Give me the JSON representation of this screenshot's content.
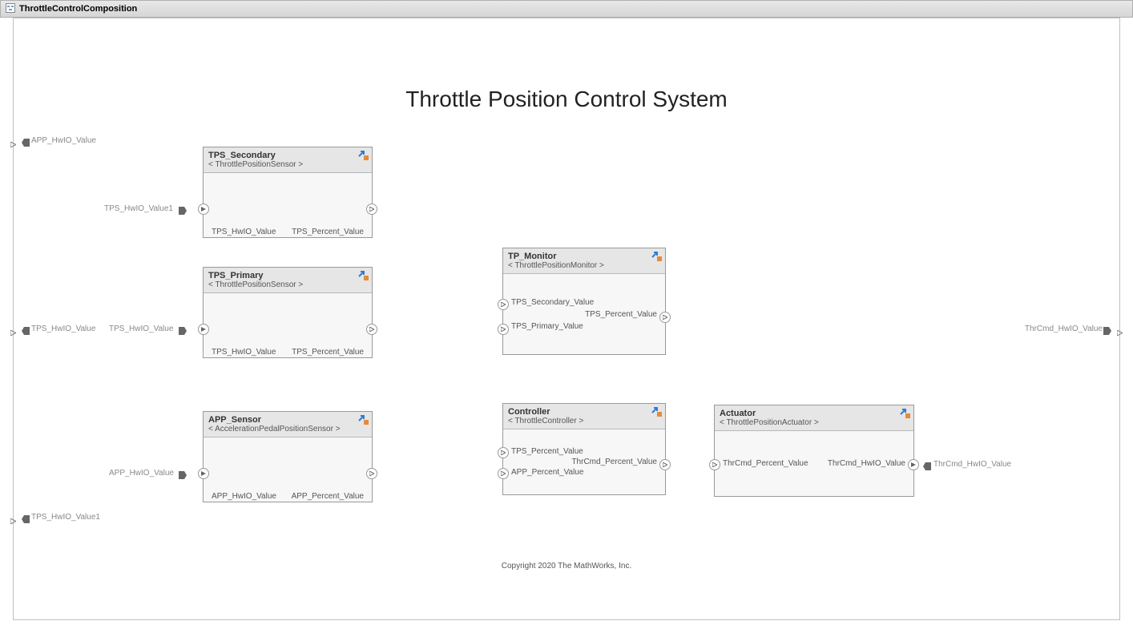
{
  "title": "ThrottleControlComposition",
  "heading": "Throttle Position Control System",
  "copyright": "Copyright 2020 The MathWorks, Inc.",
  "sideports": {
    "in1": "APP_HwIO_Value",
    "in2": "TPS_HwIO_Value",
    "in3": "TPS_HwIO_Value1",
    "out": "ThrCmd_HwIO_Value"
  },
  "extlabels": {
    "tps_sec_in": "TPS_HwIO_Value1",
    "tps_pri_in": "TPS_HwIO_Value",
    "app_in": "APP_HwIO_Value",
    "act_out": "ThrCmd_HwIO_Value"
  },
  "blocks": {
    "tps_secondary": {
      "name": "TPS_Secondary",
      "type": "< ThrottlePositionSensor >",
      "in1": "TPS_HwIO_Value",
      "out1": "TPS_Percent_Value"
    },
    "tps_primary": {
      "name": "TPS_Primary",
      "type": "< ThrottlePositionSensor >",
      "in1": "TPS_HwIO_Value",
      "out1": "TPS_Percent_Value"
    },
    "app_sensor": {
      "name": "APP_Sensor",
      "type": "< AccelerationPedalPositionSensor >",
      "in1": "APP_HwIO_Value",
      "out1": "APP_Percent_Value"
    },
    "tp_monitor": {
      "name": "TP_Monitor",
      "type": "< ThrottlePositionMonitor >",
      "in1": "TPS_Secondary_Value",
      "in2": "TPS_Primary_Value",
      "out1": "TPS_Percent_Value"
    },
    "controller": {
      "name": "Controller",
      "type": "< ThrottleController >",
      "in1": "TPS_Percent_Value",
      "in2": "APP_Percent_Value",
      "out1": "ThrCmd_Percent_Value"
    },
    "actuator": {
      "name": "Actuator",
      "type": "< ThrottlePositionActuator >",
      "in1": "ThrCmd_Percent_Value",
      "out1": "ThrCmd_HwIO_Value"
    }
  }
}
